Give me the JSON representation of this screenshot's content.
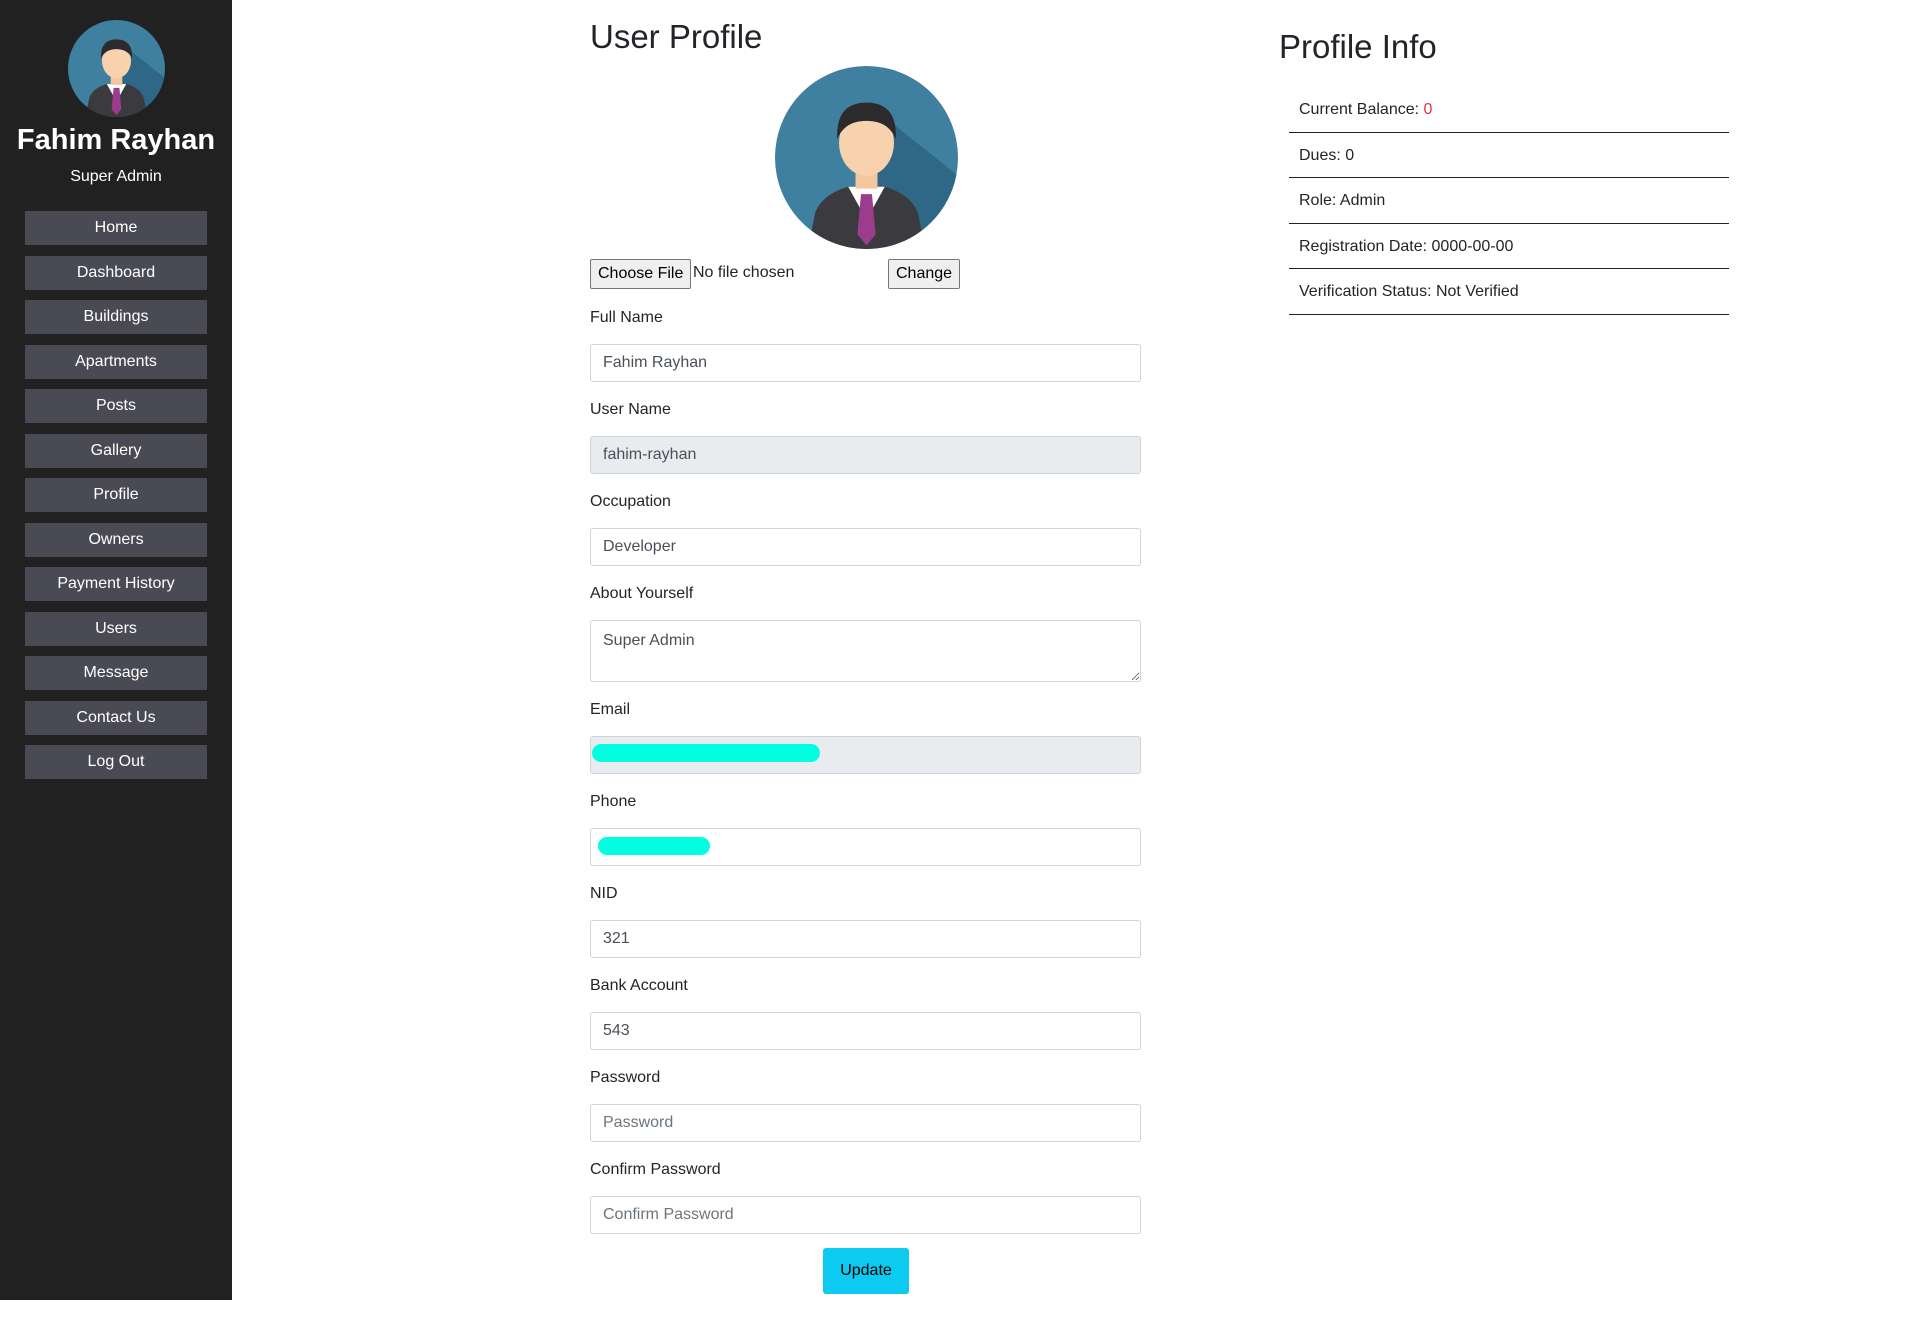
{
  "sidebar": {
    "user_name": "Fahim Rayhan",
    "user_role": "Super Admin",
    "avatar_icon": "user-avatar-icon",
    "items": [
      {
        "label": "Home"
      },
      {
        "label": "Dashboard"
      },
      {
        "label": "Buildings"
      },
      {
        "label": "Apartments"
      },
      {
        "label": "Posts"
      },
      {
        "label": "Gallery"
      },
      {
        "label": "Profile"
      },
      {
        "label": "Owners"
      },
      {
        "label": "Payment History"
      },
      {
        "label": "Users"
      },
      {
        "label": "Message"
      },
      {
        "label": "Contact Us"
      },
      {
        "label": "Log Out"
      }
    ]
  },
  "profile": {
    "title": "User Profile",
    "avatar_icon": "user-avatar-icon",
    "choose_file_label": "Choose File",
    "no_file_text": "No file chosen",
    "change_label": "Change",
    "fields": {
      "full_name": {
        "label": "Full Name",
        "value": "Fahim Rayhan"
      },
      "user_name": {
        "label": "User Name",
        "value": "fahim-rayhan"
      },
      "occupation": {
        "label": "Occupation",
        "value": "Developer"
      },
      "about": {
        "label": "About Yourself",
        "value": "Super Admin"
      },
      "email": {
        "label": "Email",
        "value": ""
      },
      "phone": {
        "label": "Phone",
        "value": ""
      },
      "nid": {
        "label": "NID",
        "value": "321"
      },
      "bank": {
        "label": "Bank Account",
        "value": "543"
      },
      "password": {
        "label": "Password",
        "placeholder": "Password"
      },
      "confirm_password": {
        "label": "Confirm Password",
        "placeholder": "Confirm Password"
      }
    },
    "update_label": "Update"
  },
  "info": {
    "title": "Profile Info",
    "balance_label": "Current Balance: ",
    "balance_value": "0",
    "dues_label": "Dues: ",
    "dues_value": "0",
    "role_label": "Role: ",
    "role_value": "Admin",
    "reg_label": "Registration Date: ",
    "reg_value": "0000-00-00",
    "verif_label": "Verification Status: ",
    "verif_value": "Not Verified"
  },
  "colors": {
    "sidebar_bg": "#212121",
    "nav_item_bg": "#4a4a55",
    "accent": "#0dcaf0",
    "danger": "#dc3545",
    "redaction": "#00ffe0"
  }
}
